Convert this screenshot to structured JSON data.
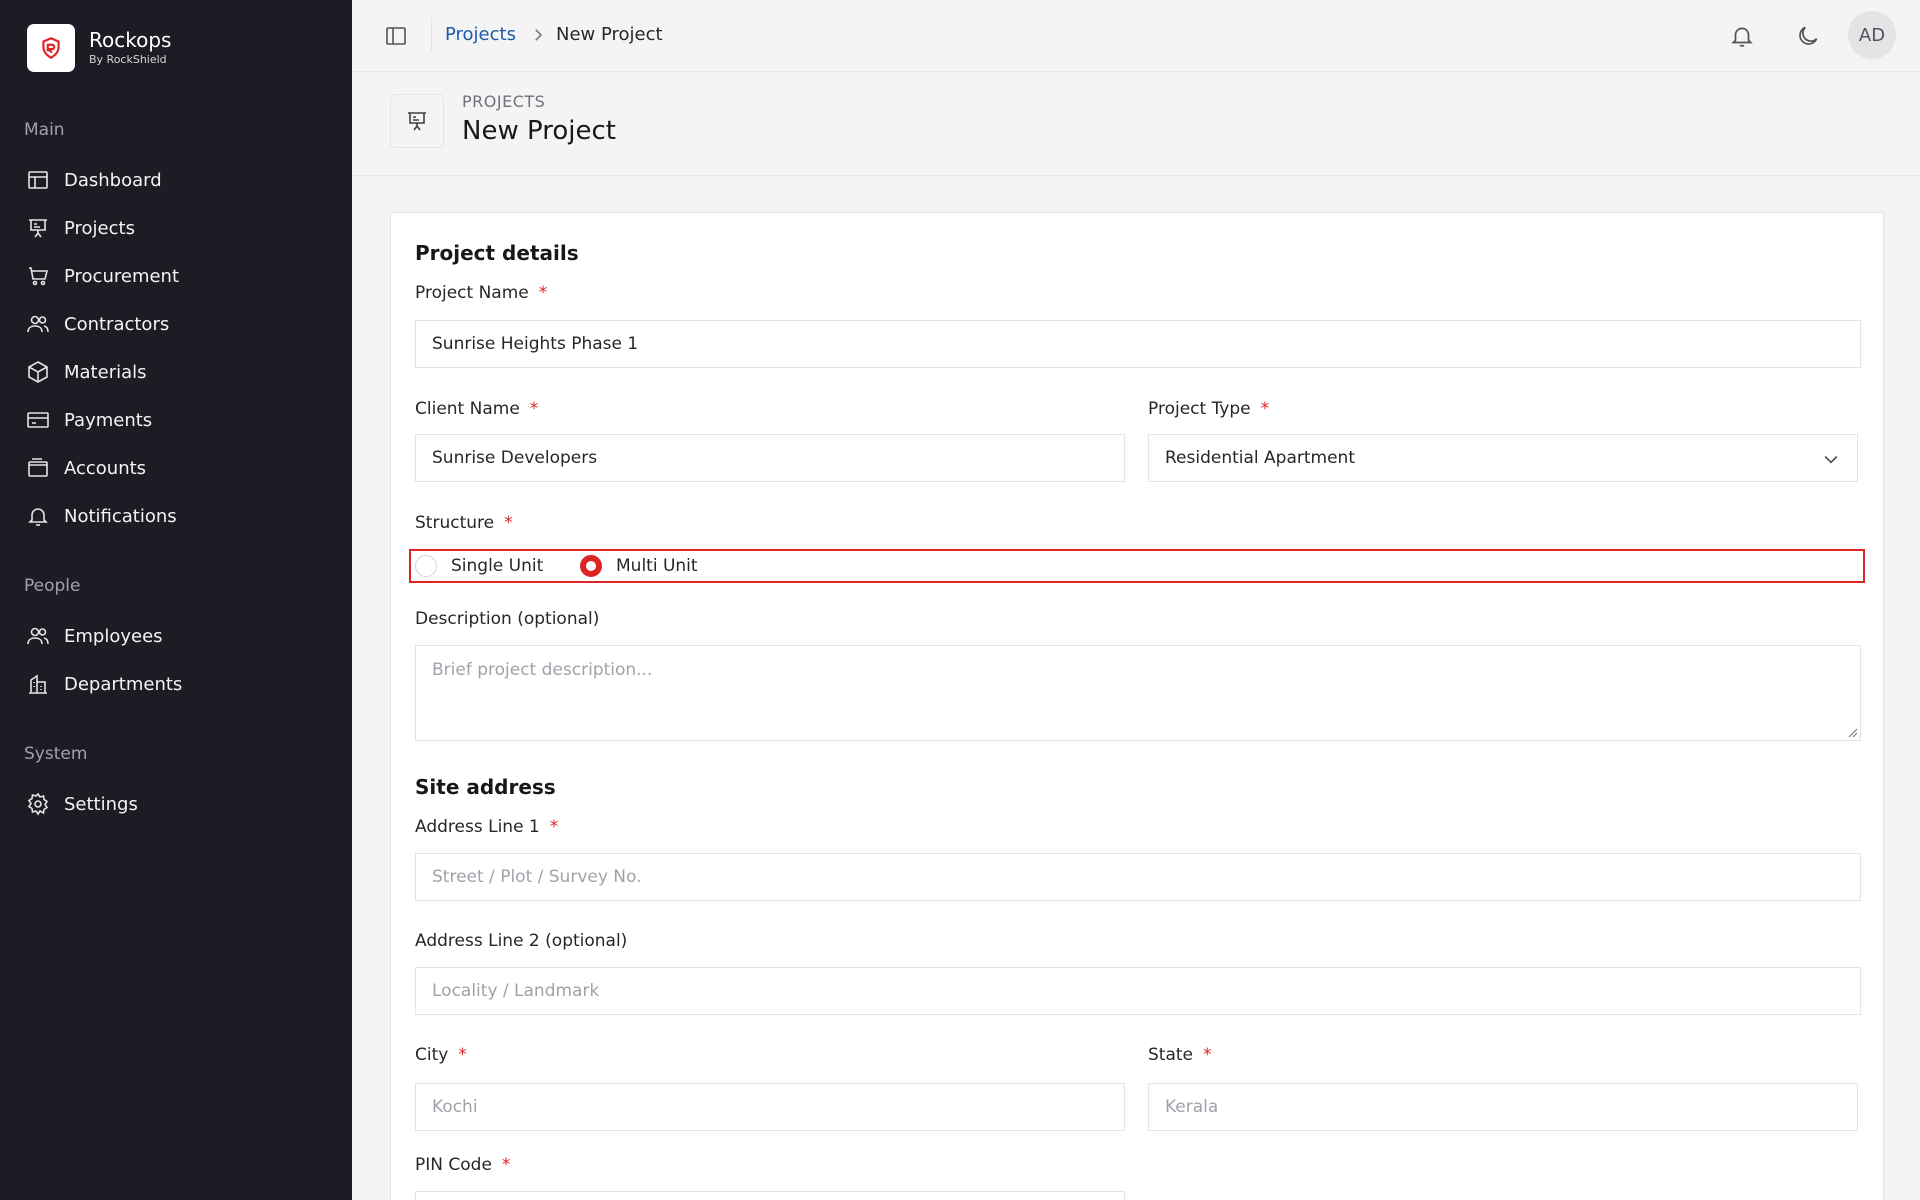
{
  "brand": {
    "name": "Rockops",
    "sub": "By RockShield"
  },
  "sidebar": {
    "sections": [
      {
        "title": "Main",
        "items": [
          {
            "label": "Dashboard",
            "icon": "dashboard-icon"
          },
          {
            "label": "Projects",
            "icon": "presentation-icon"
          },
          {
            "label": "Procurement",
            "icon": "cart-icon"
          },
          {
            "label": "Contractors",
            "icon": "users-icon"
          },
          {
            "label": "Materials",
            "icon": "box-icon"
          },
          {
            "label": "Payments",
            "icon": "card-icon"
          },
          {
            "label": "Accounts",
            "icon": "wallet-icon"
          },
          {
            "label": "Notifications",
            "icon": "bell-icon"
          }
        ]
      },
      {
        "title": "People",
        "items": [
          {
            "label": "Employees",
            "icon": "users-icon"
          },
          {
            "label": "Departments",
            "icon": "building-icon"
          }
        ]
      },
      {
        "title": "System",
        "items": [
          {
            "label": "Settings",
            "icon": "gear-icon"
          }
        ]
      }
    ]
  },
  "topbar": {
    "breadcrumb": [
      "Projects",
      "New Project"
    ],
    "avatar": "AD"
  },
  "page": {
    "eyebrow": "PROJECTS",
    "title": "New Project"
  },
  "form": {
    "details_title": "Project details",
    "project_name": {
      "label": "Project Name",
      "value": "Sunrise Heights Phase 1"
    },
    "client_name": {
      "label": "Client Name",
      "value": "Sunrise Developers"
    },
    "project_type": {
      "label": "Project Type",
      "value": "Residential Apartment"
    },
    "structure": {
      "label": "Structure",
      "options": [
        "Single Unit",
        "Multi Unit"
      ],
      "selected": "Multi Unit"
    },
    "description": {
      "label": "Description (optional)",
      "placeholder": "Brief project description..."
    },
    "address_title": "Site address",
    "address1": {
      "label": "Address Line 1",
      "placeholder": "Street / Plot / Survey No."
    },
    "address2": {
      "label": "Address Line 2 (optional)",
      "placeholder": "Locality / Landmark"
    },
    "city": {
      "label": "City",
      "placeholder": "Kochi"
    },
    "state": {
      "label": "State",
      "placeholder": "Kerala"
    },
    "pin": {
      "label": "PIN Code"
    }
  },
  "colors": {
    "sidebar_bg": "#1c1d24",
    "accent": "#dc2626",
    "link": "#1e5aa8"
  }
}
